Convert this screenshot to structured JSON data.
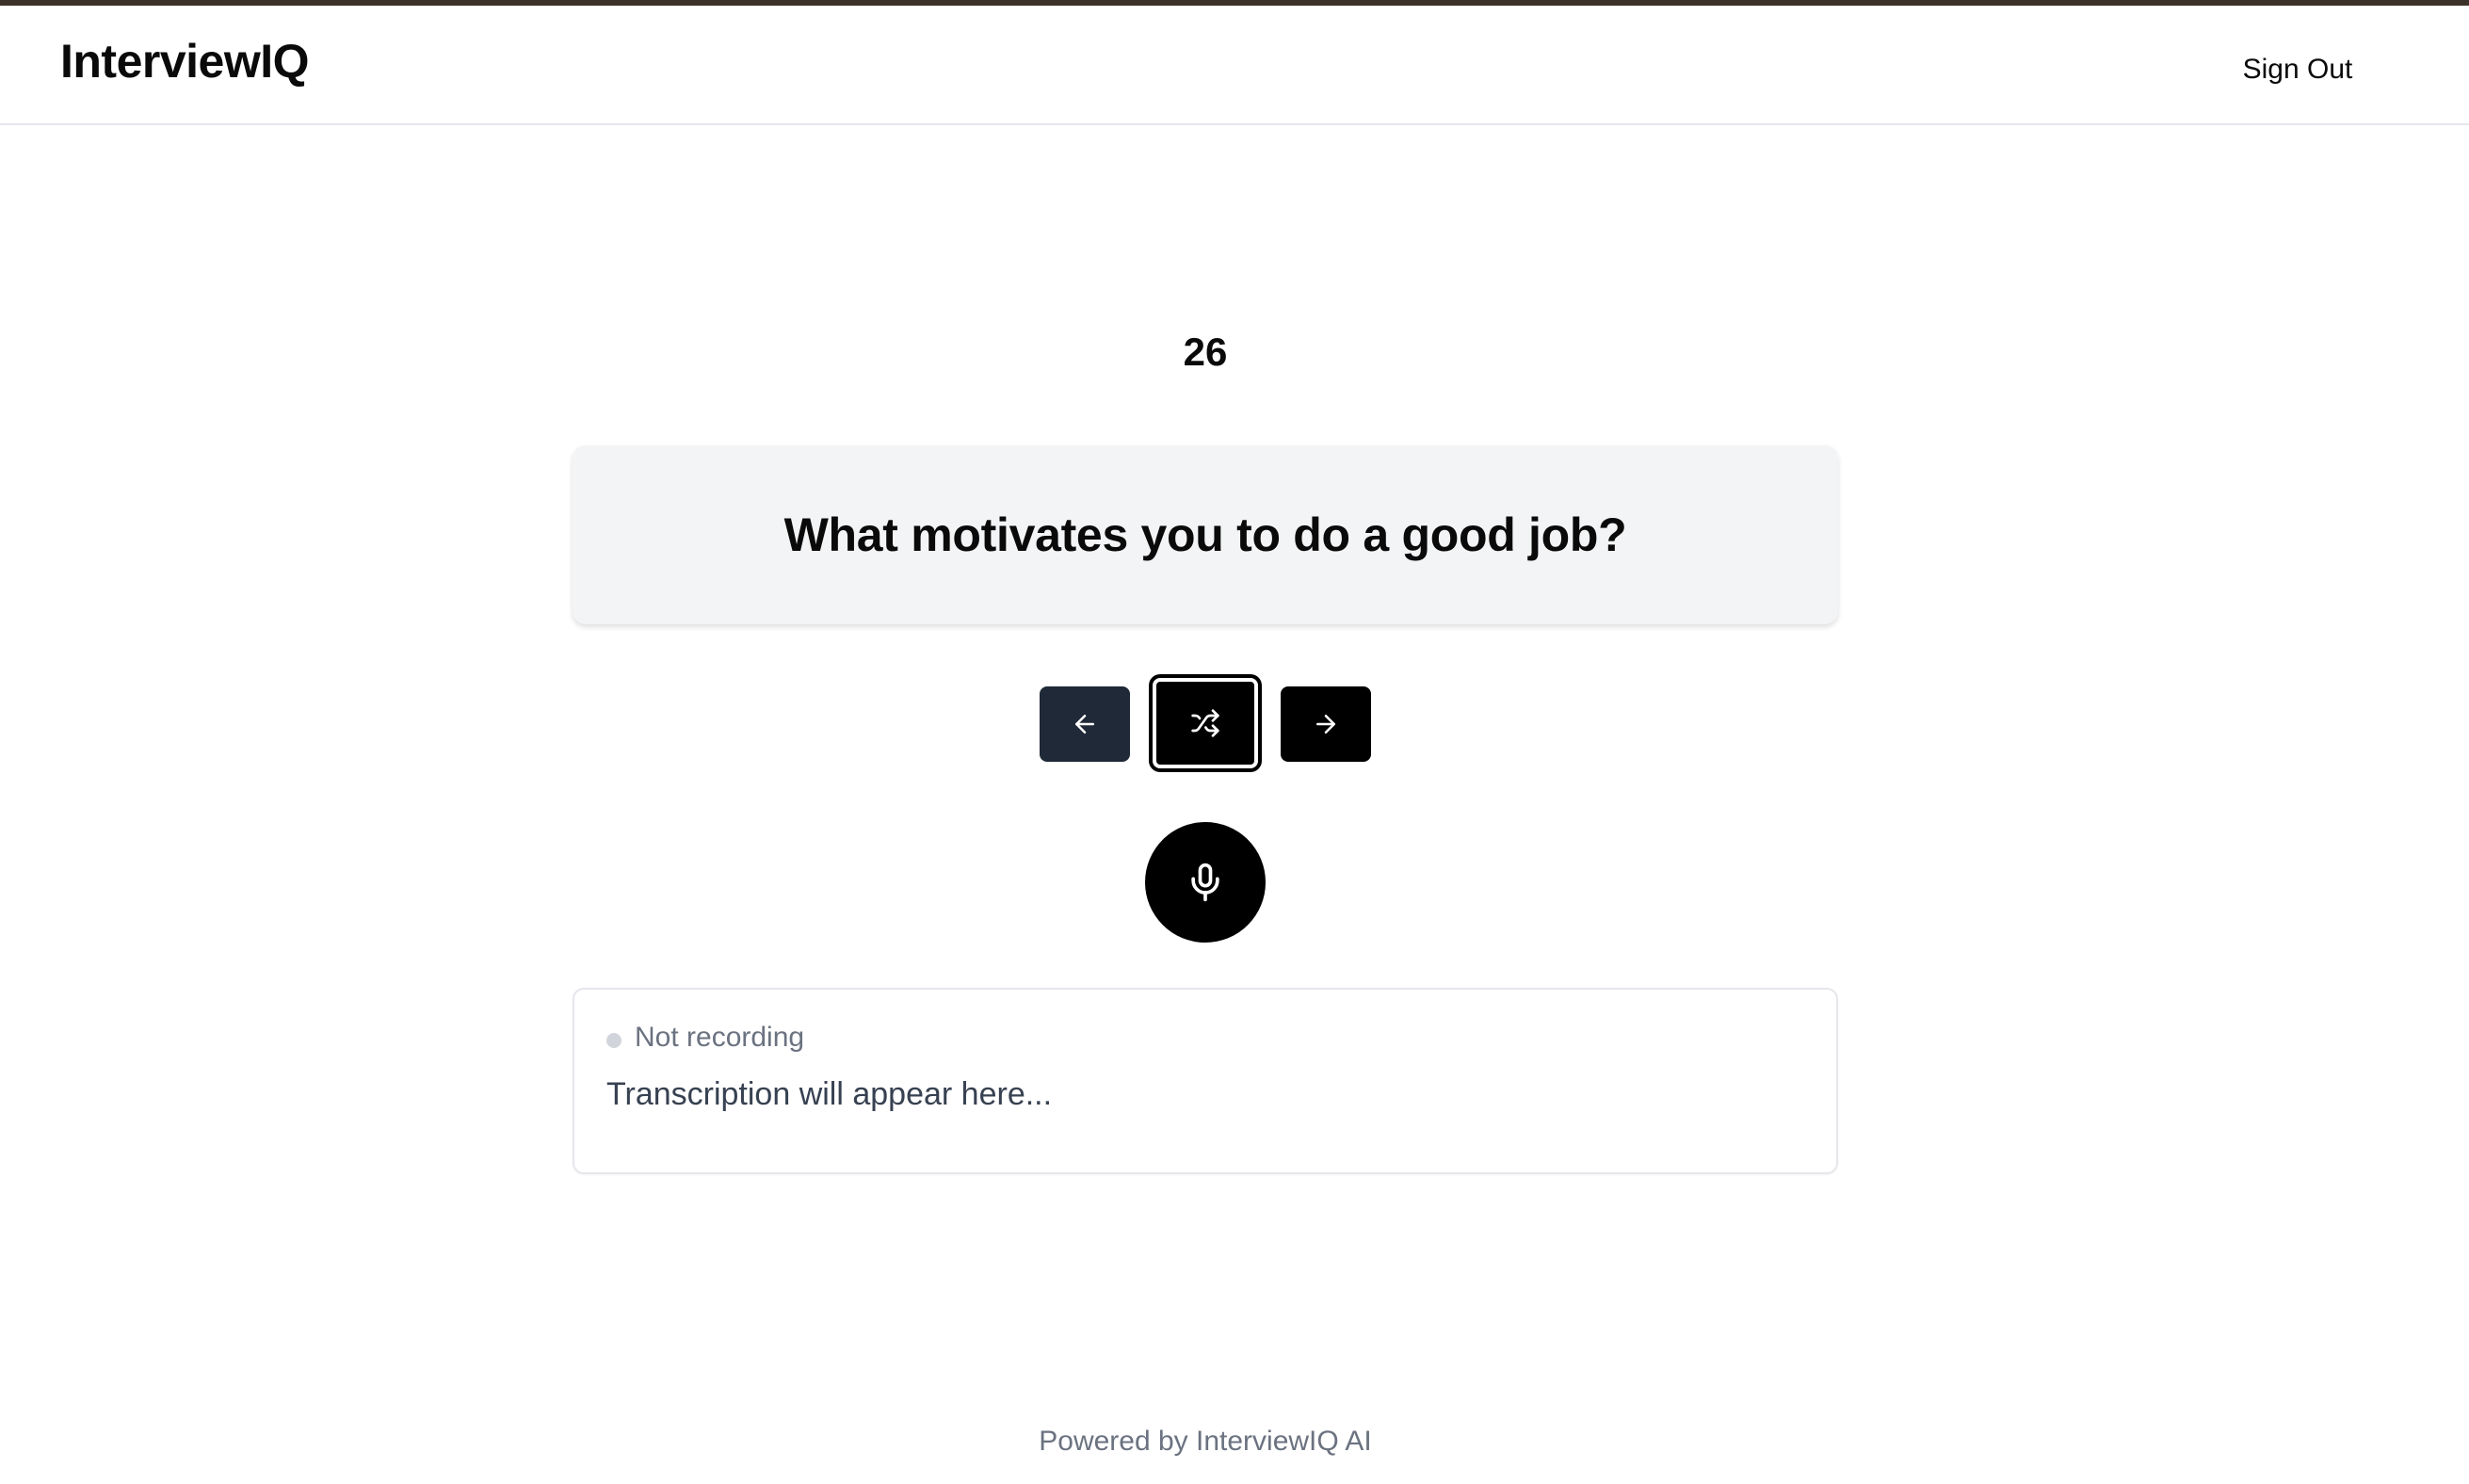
{
  "header": {
    "brand": "InterviewIQ",
    "sign_out_label": "Sign Out"
  },
  "question": {
    "number": "26",
    "text": "What motivates you to do a good job?"
  },
  "controls": {
    "previous_icon": "arrow-left-icon",
    "shuffle_icon": "shuffle-icon",
    "next_icon": "arrow-right-icon",
    "mic_icon": "microphone-icon"
  },
  "transcription": {
    "status": "Not recording",
    "placeholder": "Transcription will appear here..."
  },
  "footer": {
    "text": "Powered by InterviewIQ AI"
  },
  "colors": {
    "top_strip": "#3d3229",
    "card_bg": "#f3f4f6",
    "button_dark": "#1f2937",
    "button_black": "#000000",
    "muted_text": "#6b7280"
  }
}
